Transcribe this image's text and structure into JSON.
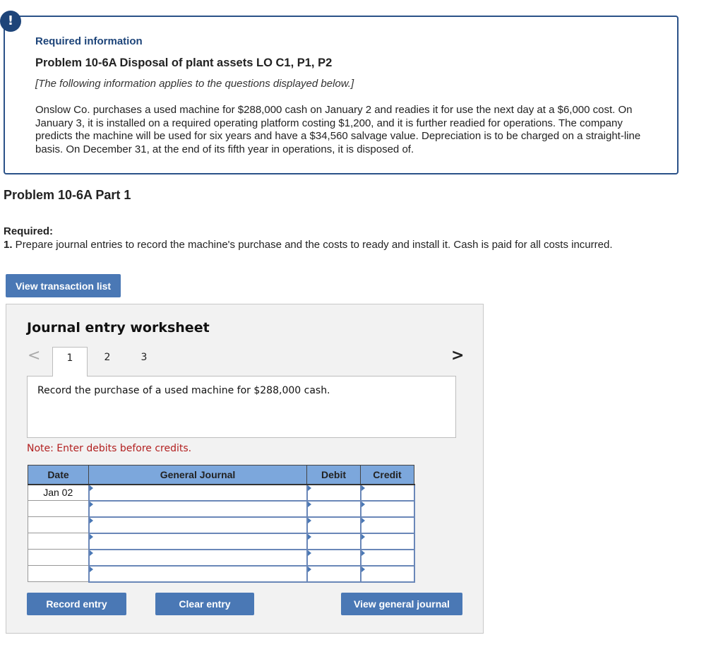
{
  "info": {
    "badge_icon": "!",
    "heading": "Required information",
    "title": "Problem 10-6A Disposal of plant assets LO C1, P1, P2",
    "note": "[The following information applies to the questions displayed below.]",
    "body": "Onslow Co. purchases a used machine for $288,000 cash on January 2 and readies it for use the next day at a $6,000 cost. On January 3, it is installed on a required operating platform costing $1,200, and it is further readied for operations. The company predicts the machine will be used for six years and have a $34,560 salvage value. Depreciation is to be charged on a straight-line basis. On December 31, at the end of its fifth year in operations, it is disposed of."
  },
  "part": {
    "title": "Problem 10-6A Part 1",
    "required_label": "Required:",
    "required_number": "1.",
    "required_text": " Prepare journal entries to record the machine's purchase and the costs to ready and install it. Cash is paid for all costs incurred."
  },
  "buttons": {
    "view_transactions": "View transaction list",
    "record_entry": "Record entry",
    "clear_entry": "Clear entry",
    "view_general_journal": "View general journal"
  },
  "worksheet": {
    "title": "Journal entry worksheet",
    "prev_icon": "<",
    "next_icon": ">",
    "tabs": [
      {
        "label": "1",
        "active": true
      },
      {
        "label": "2",
        "active": false
      },
      {
        "label": "3",
        "active": false
      }
    ],
    "prompt": "Record the purchase of a used machine for $288,000 cash.",
    "note": "Note: Enter debits before credits.",
    "table": {
      "headers": [
        "Date",
        "General Journal",
        "Debit",
        "Credit"
      ],
      "rows": [
        {
          "date": "Jan 02",
          "account": "",
          "debit": "",
          "credit": ""
        },
        {
          "date": "",
          "account": "",
          "debit": "",
          "credit": ""
        },
        {
          "date": "",
          "account": "",
          "debit": "",
          "credit": ""
        },
        {
          "date": "",
          "account": "",
          "debit": "",
          "credit": ""
        },
        {
          "date": "",
          "account": "",
          "debit": "",
          "credit": ""
        },
        {
          "date": "",
          "account": "",
          "debit": "",
          "credit": ""
        }
      ]
    }
  },
  "colors": {
    "brand_blue": "#4a78b5",
    "header_blue": "#7ca7dc",
    "info_border": "#2b5288",
    "note_red": "#b21f1f"
  }
}
